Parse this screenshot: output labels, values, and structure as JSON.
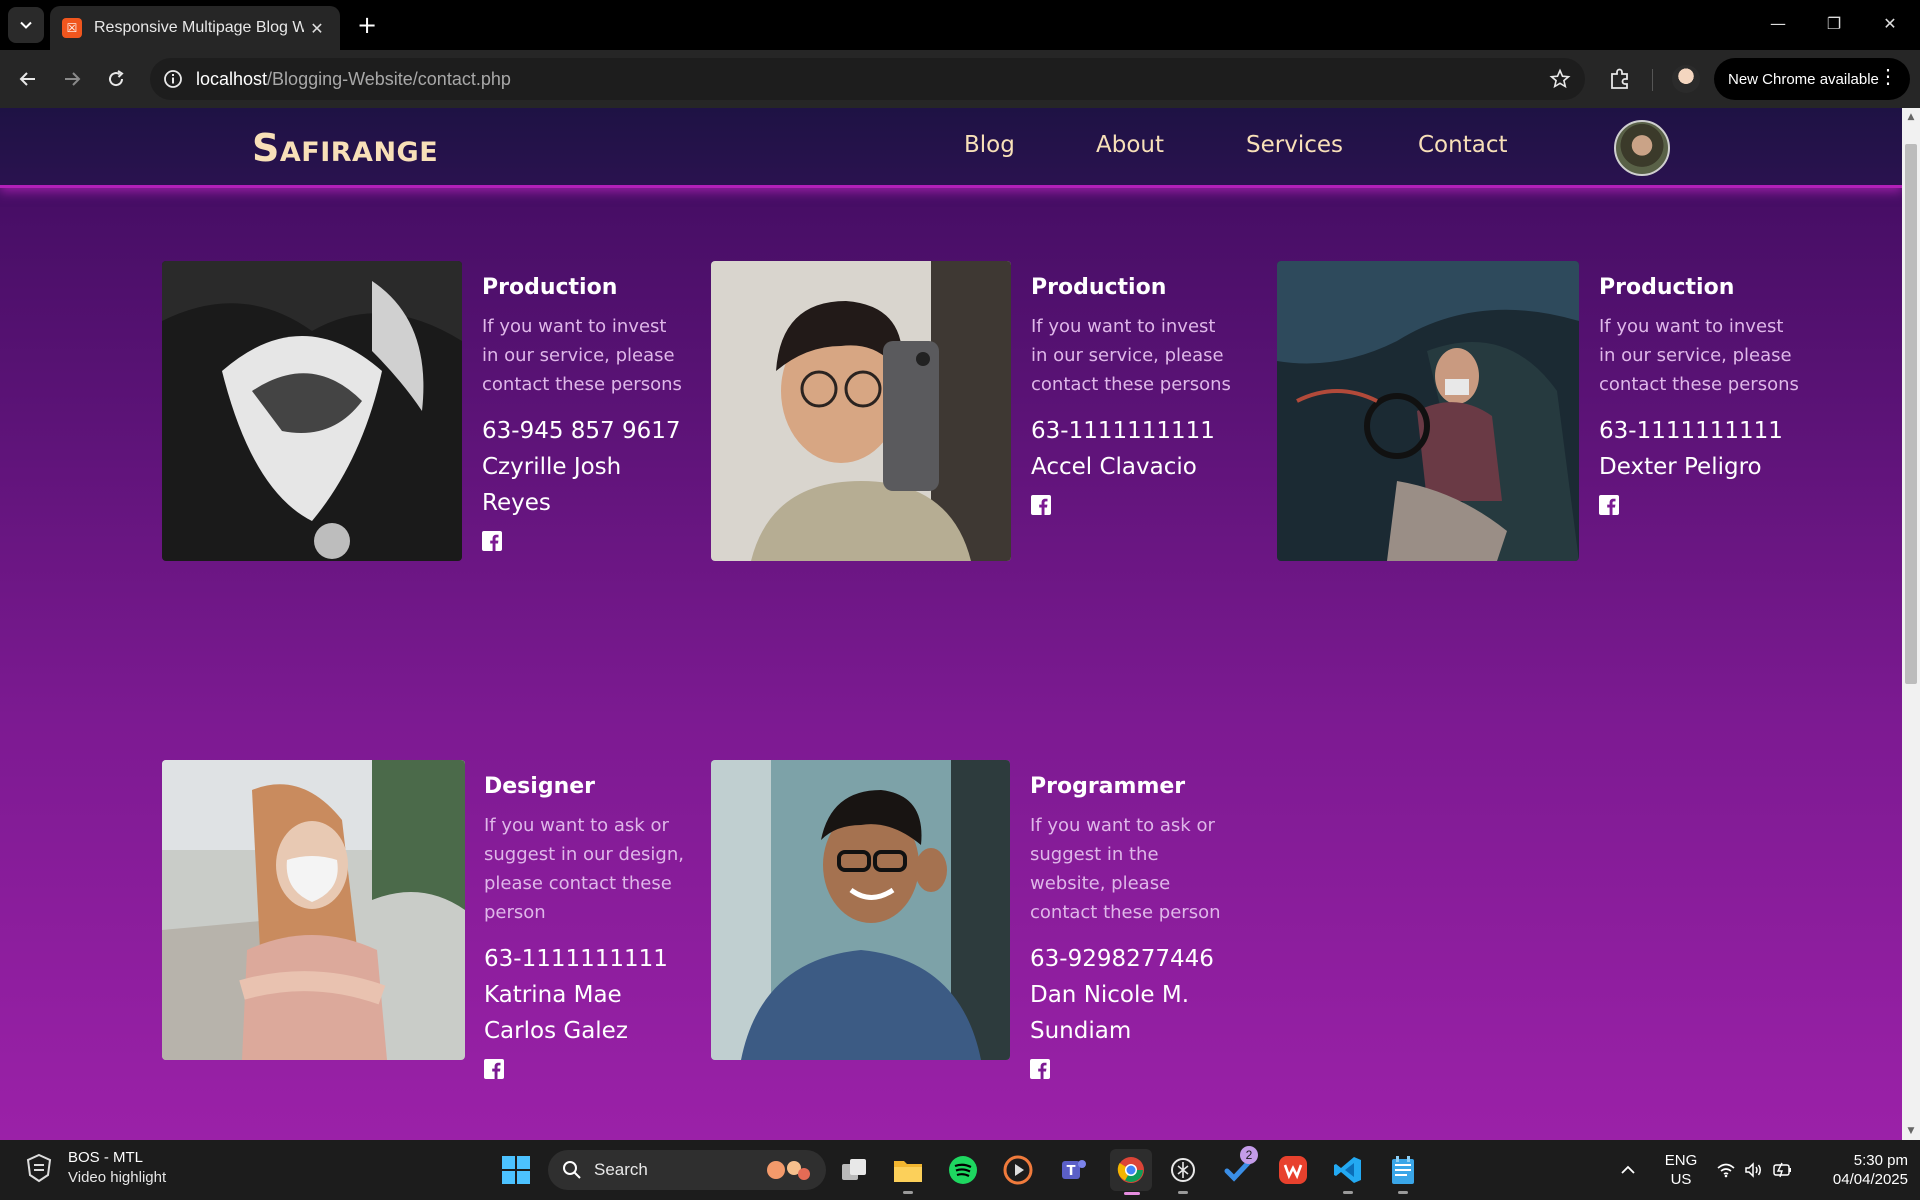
{
  "browser": {
    "tab_title": "Responsive Multipage Blog Website",
    "url_host": "localhost",
    "url_path": "/Blogging-Website/contact.php",
    "update_label": "New Chrome available"
  },
  "site": {
    "logo": "Safirange",
    "nav": [
      "Blog",
      "About",
      "Services",
      "Contact"
    ]
  },
  "contacts": [
    {
      "role": "Production",
      "description": "If you want to invest in our service, please contact these persons",
      "phone": "63-945 857 9617",
      "name": "Czyrille Josh Reyes",
      "social_icon": "facebook-icon"
    },
    {
      "role": "Production",
      "description": "If you want to invest in our service, please contact these persons",
      "phone": "63-1111111111",
      "name": "Accel Clavacio",
      "social_icon": "facebook-icon"
    },
    {
      "role": "Production",
      "description": "If you want to invest in our service, please contact these persons",
      "phone": "63-1111111111",
      "name": "Dexter Peligro",
      "social_icon": "facebook-icon"
    },
    {
      "role": "Designer",
      "description": "If you want to ask or suggest in our design, please contact these person",
      "phone": "63-1111111111",
      "name": "Katrina Mae Carlos Galez",
      "social_icon": "facebook-icon"
    },
    {
      "role": "Programmer",
      "description": "If you want to ask or suggest in the website, please contact these person",
      "phone": "63-9298277446",
      "name": "Dan Nicole M. Sundiam",
      "social_icon": "facebook-icon"
    }
  ],
  "taskbar": {
    "widget_title": "BOS - MTL",
    "widget_subtitle": "Video highlight",
    "search_label": "Search",
    "todo_badge": "2",
    "lang_top": "ENG",
    "lang_bottom": "US",
    "time": "5:30 pm",
    "date": "04/04/2025"
  },
  "colors": {
    "header_bg": "#2a124f",
    "logo_text": "#f8e0b8",
    "page_gradient_top": "#3e0c5e",
    "page_gradient_bottom": "#9b21a8",
    "description_text": "#dfb7e9"
  }
}
